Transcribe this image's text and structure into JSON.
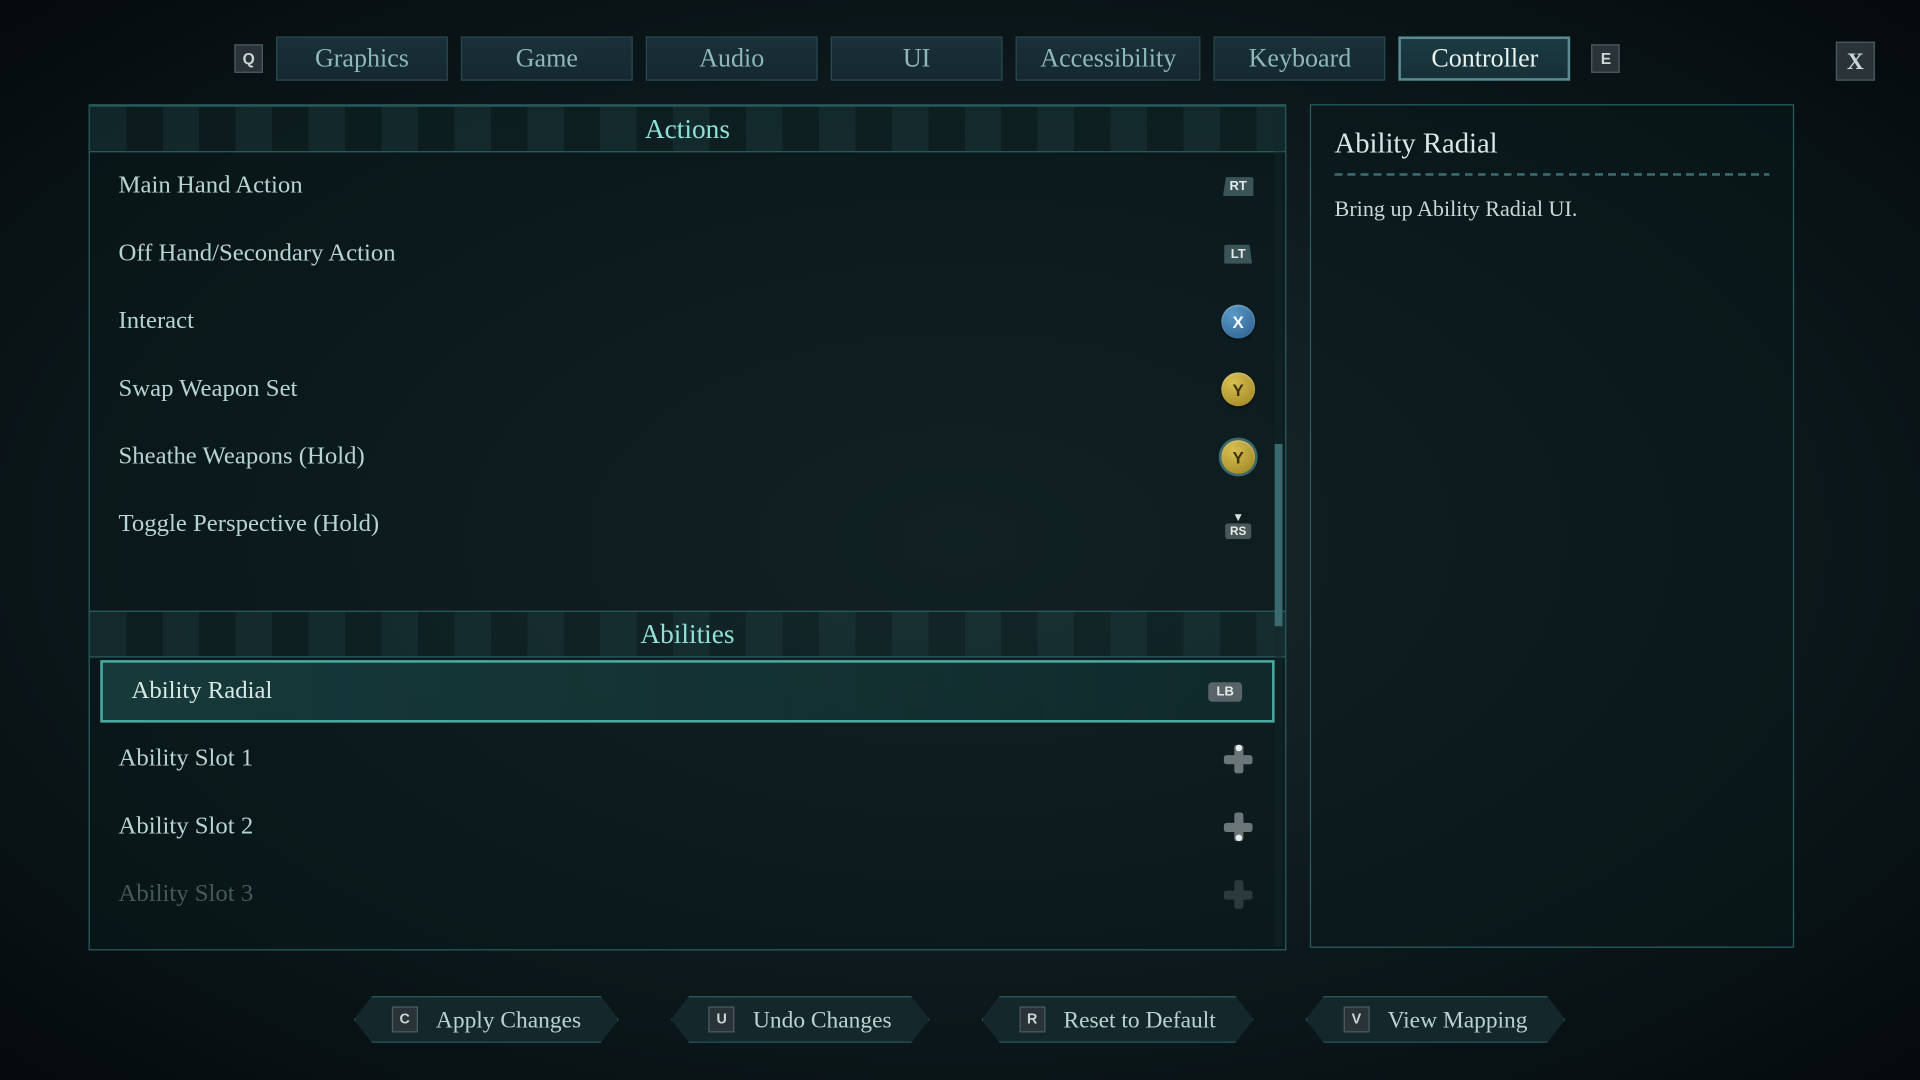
{
  "tabs": {
    "prev_key": "Q",
    "next_key": "E",
    "items": [
      "Graphics",
      "Game",
      "Audio",
      "UI",
      "Accessibility",
      "Keyboard",
      "Controller"
    ],
    "active_index": 6
  },
  "close_label": "X",
  "sections": [
    {
      "title": "Actions",
      "rows": [
        {
          "label": "Main Hand Action",
          "icon": "RT"
        },
        {
          "label": "Off Hand/Secondary Action",
          "icon": "LT"
        },
        {
          "label": "Interact",
          "icon": "X"
        },
        {
          "label": "Swap Weapon Set",
          "icon": "Y"
        },
        {
          "label": "Sheathe Weapons (Hold)",
          "icon": "Y_hold"
        },
        {
          "label": "Toggle Perspective (Hold)",
          "icon": "RS_click"
        }
      ]
    },
    {
      "title": "Abilities",
      "rows": [
        {
          "label": "Ability Radial",
          "icon": "LB",
          "selected": true
        },
        {
          "label": "Ability Slot 1",
          "icon": "DPAD_UP"
        },
        {
          "label": "Ability Slot 2",
          "icon": "DPAD_DOWN"
        },
        {
          "label": "Ability Slot 3",
          "icon": "DPAD_LEFT"
        }
      ]
    }
  ],
  "detail": {
    "title": "Ability Radial",
    "description": "Bring up Ability Radial UI."
  },
  "footer": {
    "apply": {
      "key": "C",
      "label": "Apply Changes"
    },
    "undo": {
      "key": "U",
      "label": "Undo Changes"
    },
    "reset": {
      "key": "R",
      "label": "Reset to Default"
    },
    "mapping": {
      "key": "V",
      "label": "View Mapping"
    }
  }
}
